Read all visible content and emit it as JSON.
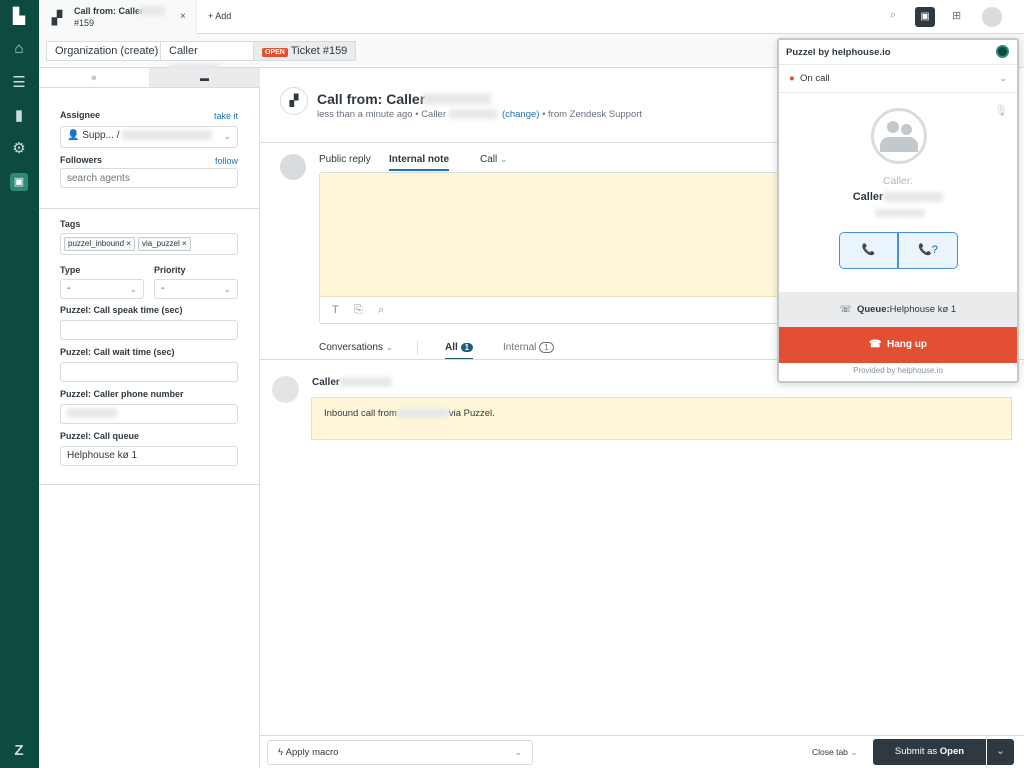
{
  "nav": {
    "items": [
      "logo",
      "home",
      "views",
      "reporting",
      "admin",
      "puzzel-app"
    ]
  },
  "tab": {
    "title": "Call from: Caller",
    "number": "#159",
    "add": "+ Add"
  },
  "breadcrumb": {
    "org": "Organization (create)",
    "caller": "Caller",
    "status": "OPEN",
    "ticket": "Ticket #159"
  },
  "left": {
    "assignee_label": "Assignee",
    "take_it": "take it",
    "assignee_value": "Supp... /",
    "followers_label": "Followers",
    "follow": "follow",
    "followers_placeholder": "search agents",
    "tags_label": "Tags",
    "tags": [
      "puzzel_inbound",
      "via_puzzel"
    ],
    "type_label": "Type",
    "type_value": "-",
    "priority_label": "Priority",
    "priority_value": "-",
    "speak_label": "Puzzel: Call speak time (sec)",
    "wait_label": "Puzzel: Call wait time (sec)",
    "phone_label": "Puzzel: Caller phone number",
    "queue_label": "Puzzel: Call queue",
    "queue_value": "Helphouse kø 1"
  },
  "ticket": {
    "title": "Call from: Caller",
    "meta_prefix": "less than a minute ago • Caller",
    "change": "(change)",
    "meta_suffix": "• from Zendesk Support"
  },
  "composer": {
    "tabs": [
      "Public reply",
      "Internal note",
      "Call"
    ]
  },
  "conversations": {
    "filter": "Conversations",
    "all": "All",
    "all_count": "1",
    "internal": "Internal",
    "internal_count": "1"
  },
  "event": {
    "author": "Caller",
    "text_prefix": "Inbound call from",
    "text_suffix": "via Puzzel."
  },
  "footer": {
    "macro": "Apply macro",
    "close_tab": "Close tab",
    "submit_prefix": "Submit as ",
    "submit_status": "Open"
  },
  "popup": {
    "title": "Puzzel by helphouse.io",
    "status": "On call",
    "caller_label": "Caller:",
    "caller_name": "Caller",
    "queue_label": "Queue:",
    "queue_value": "Helphouse kø 1",
    "hangup": "Hang up",
    "provided": "Provided by helphouse.io",
    "accent": "#e34f32"
  }
}
